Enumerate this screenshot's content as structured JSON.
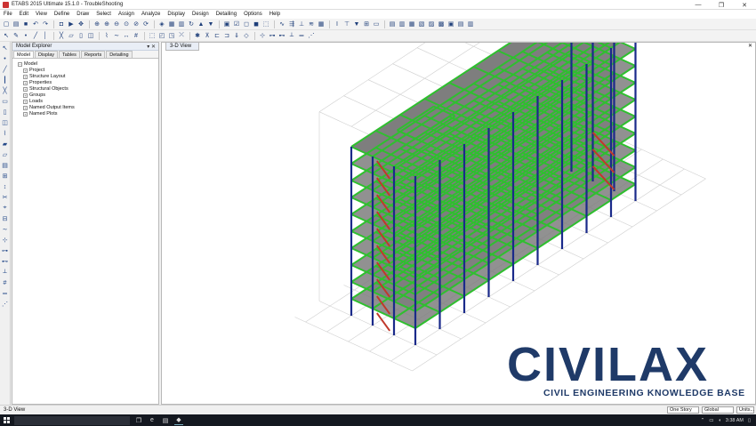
{
  "window": {
    "title": "ETABS 2015 Ultimate 15.1.0 - TroubleShooting",
    "minimize": "—",
    "maximize": "❐",
    "close": "✕"
  },
  "menu": [
    "File",
    "Edit",
    "View",
    "Define",
    "Draw",
    "Select",
    "Assign",
    "Analyze",
    "Display",
    "Design",
    "Detailing",
    "Options",
    "Help"
  ],
  "explorer": {
    "title": "Model Explorer",
    "tabs": [
      "Model",
      "Display",
      "Tables",
      "Reports",
      "Detailing"
    ],
    "root": "Model",
    "items": [
      "Project",
      "Structure Layout",
      "Properties",
      "Structural Objects",
      "Groups",
      "Loads",
      "Named Output Items",
      "Named Plots"
    ]
  },
  "view": {
    "tab_label": "3-D View"
  },
  "watermark": {
    "brand": "CIVILAX",
    "tagline": "CIVIL ENGINEERING KNOWLEDGE BASE"
  },
  "status": {
    "left": "3-D View",
    "story": "One Story",
    "coord": "Global",
    "units": "Units..."
  },
  "taskbar": {
    "time": "3:38 AM"
  },
  "colors": {
    "beam": "#2fbf2f",
    "column": "#1a2a8a",
    "slab": "#7e7e7e",
    "brace": "#c0392b",
    "brand": "#1f3a68"
  }
}
